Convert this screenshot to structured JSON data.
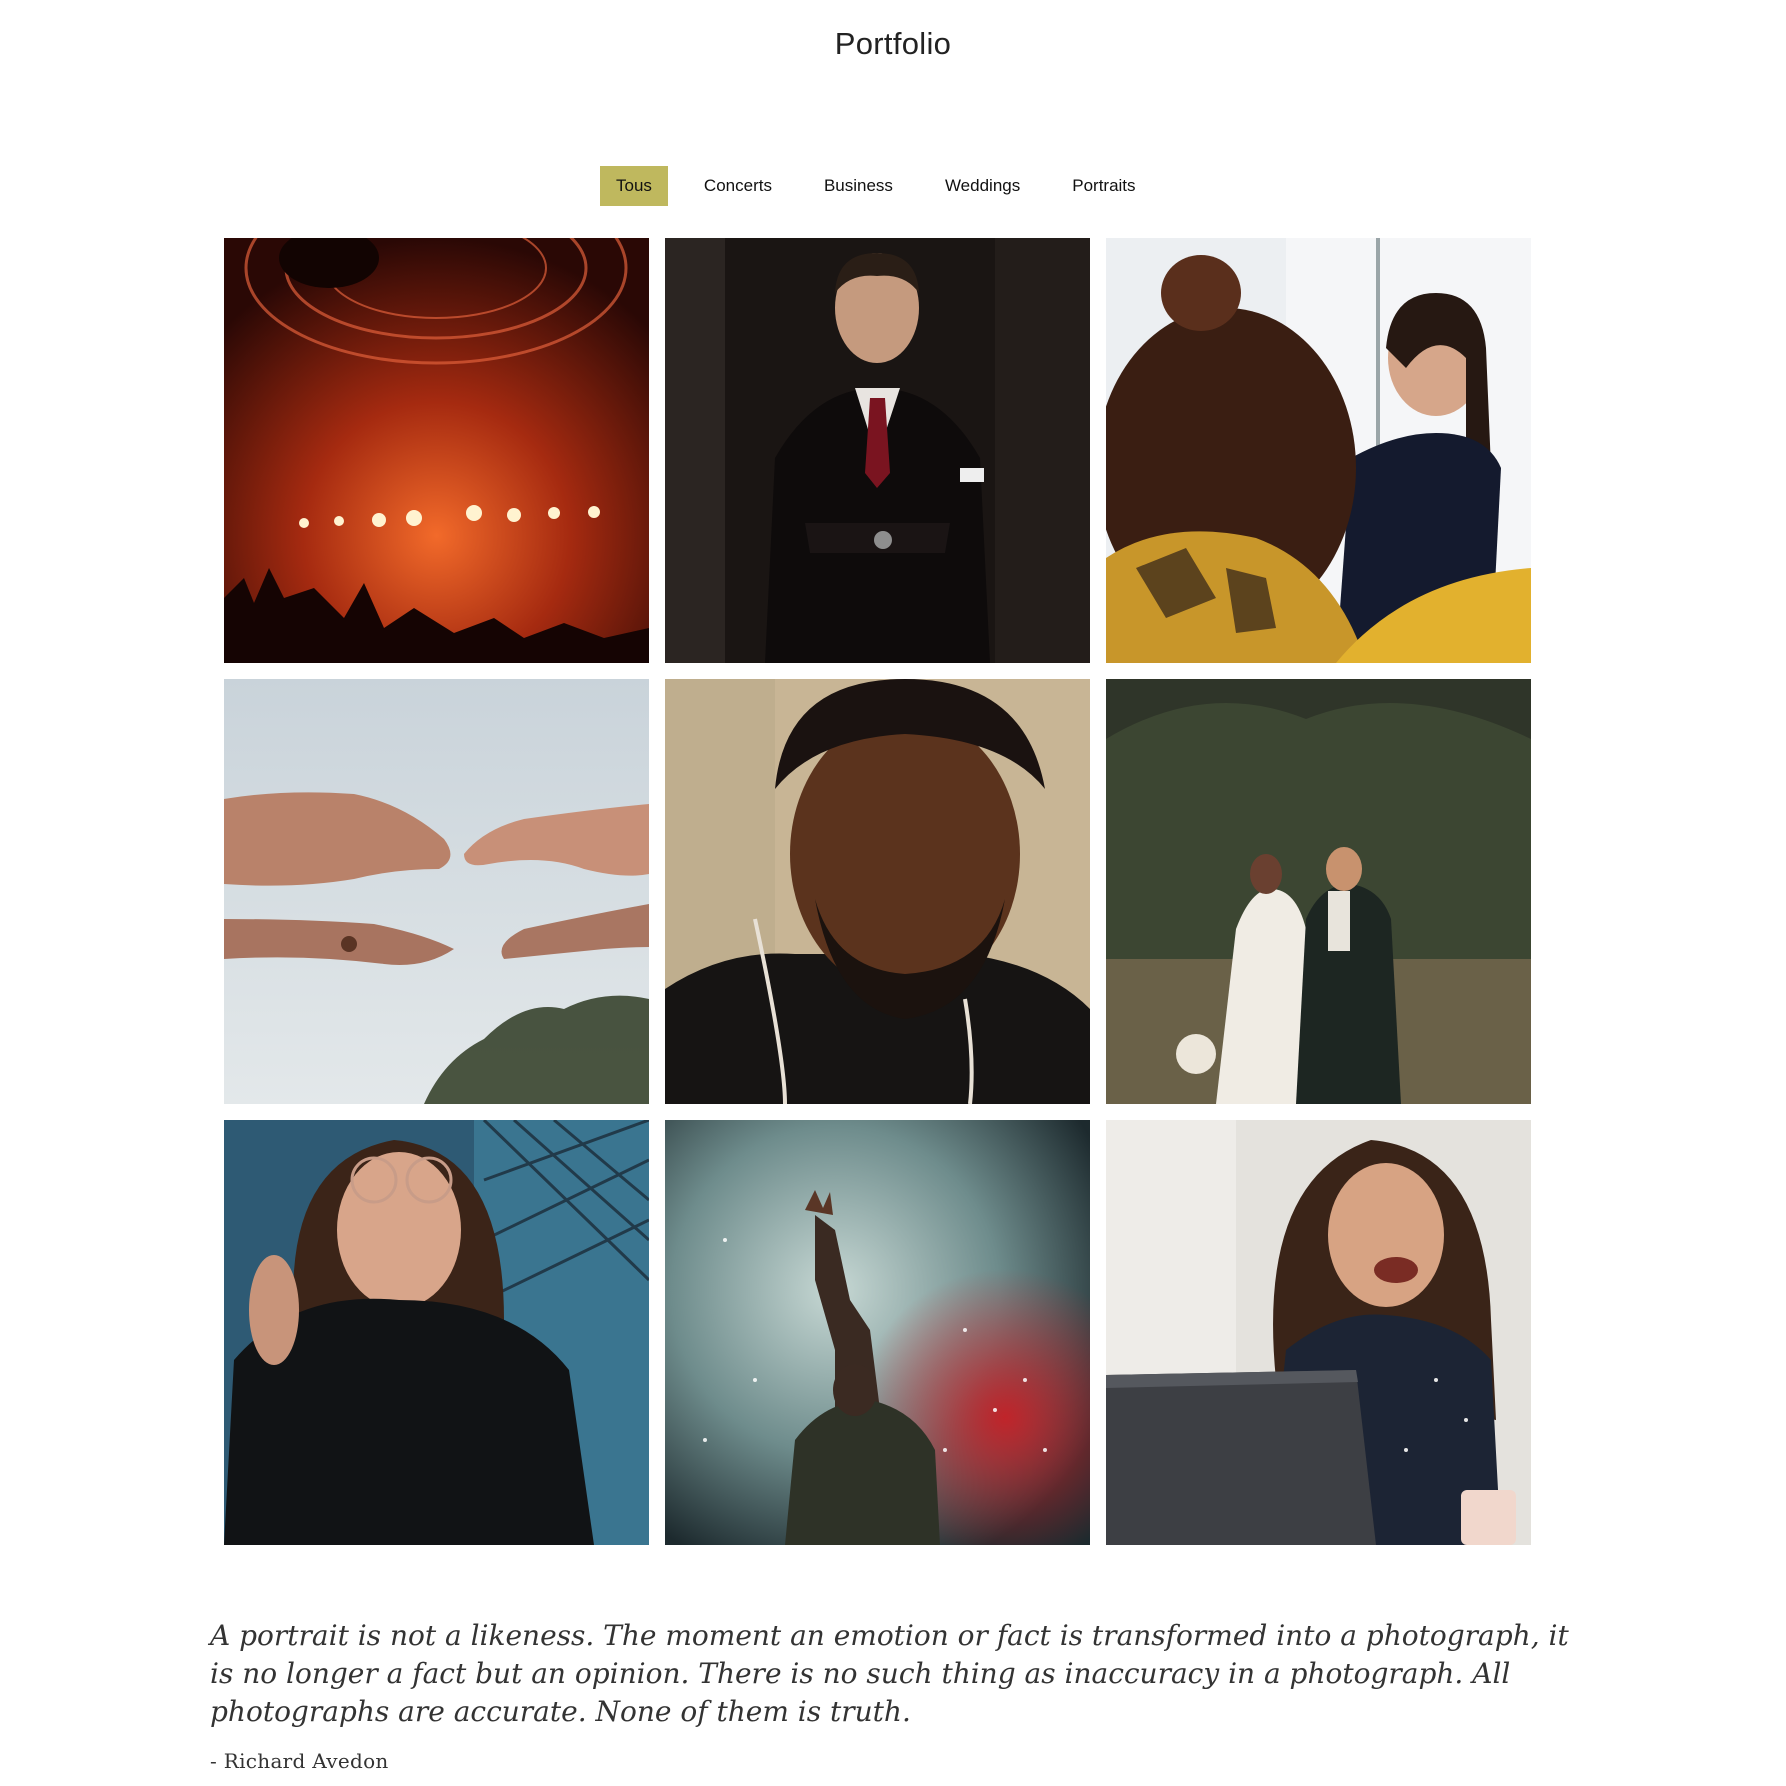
{
  "header": {
    "title": "Portfolio"
  },
  "filters": [
    {
      "label": "Tous",
      "active": true
    },
    {
      "label": "Concerts",
      "active": false
    },
    {
      "label": "Business",
      "active": false
    },
    {
      "label": "Weddings",
      "active": false
    },
    {
      "label": "Portraits",
      "active": false
    }
  ],
  "colors": {
    "accent": "#bfb85e",
    "text": "#222222",
    "background": "#ffffff"
  },
  "gallery": {
    "photos": [
      {
        "subject": "concert-stage-red-lights"
      },
      {
        "subject": "businessman-in-suit"
      },
      {
        "subject": "smiling-woman-at-meeting"
      },
      {
        "subject": "wedding-hands-with-ring"
      },
      {
        "subject": "man-eyes-closed-portrait"
      },
      {
        "subject": "wedding-couple-under-palm"
      },
      {
        "subject": "woman-with-glasses-portrait"
      },
      {
        "subject": "performer-in-smoke"
      },
      {
        "subject": "laughing-woman-with-laptop"
      }
    ]
  },
  "quote": {
    "text": "A portrait is not a likeness. The moment an emotion or fact is transformed into a photograph, it is no longer a fact but an opinion. There is no such thing as inaccuracy in a photograph. All photographs are accurate. None of them is truth.",
    "author": "- Richard Avedon"
  }
}
